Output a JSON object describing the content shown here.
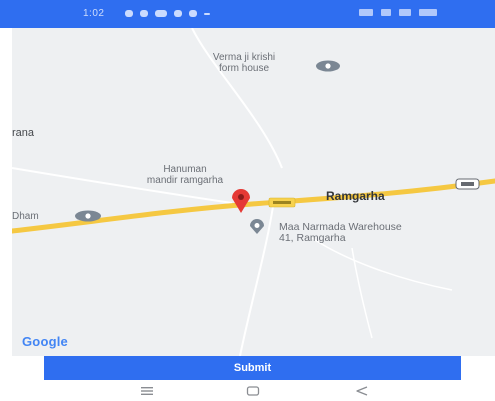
{
  "status_bar": {
    "time": "1:02",
    "background_color": "#2f6ef0"
  },
  "map": {
    "labels": {
      "farm_house": "Verma ji krishi\nform house",
      "left_place": "rana",
      "hanuman_mandir": "Hanuman\nmandir ramgarha",
      "ramgarha": "Ramgarha",
      "dham": "Dham",
      "warehouse": "Maa Narmada Warehouse\n41, Ramgarha"
    },
    "road_color": "#f5c842",
    "marker_color": "#e53935",
    "poi_icon_color": "#7b8794",
    "attribution": "Google"
  },
  "submit": {
    "label": "Submit",
    "color": "#2f6ef0"
  },
  "nav": {
    "icons": [
      "menu-icon",
      "home-icon",
      "back-icon"
    ]
  }
}
